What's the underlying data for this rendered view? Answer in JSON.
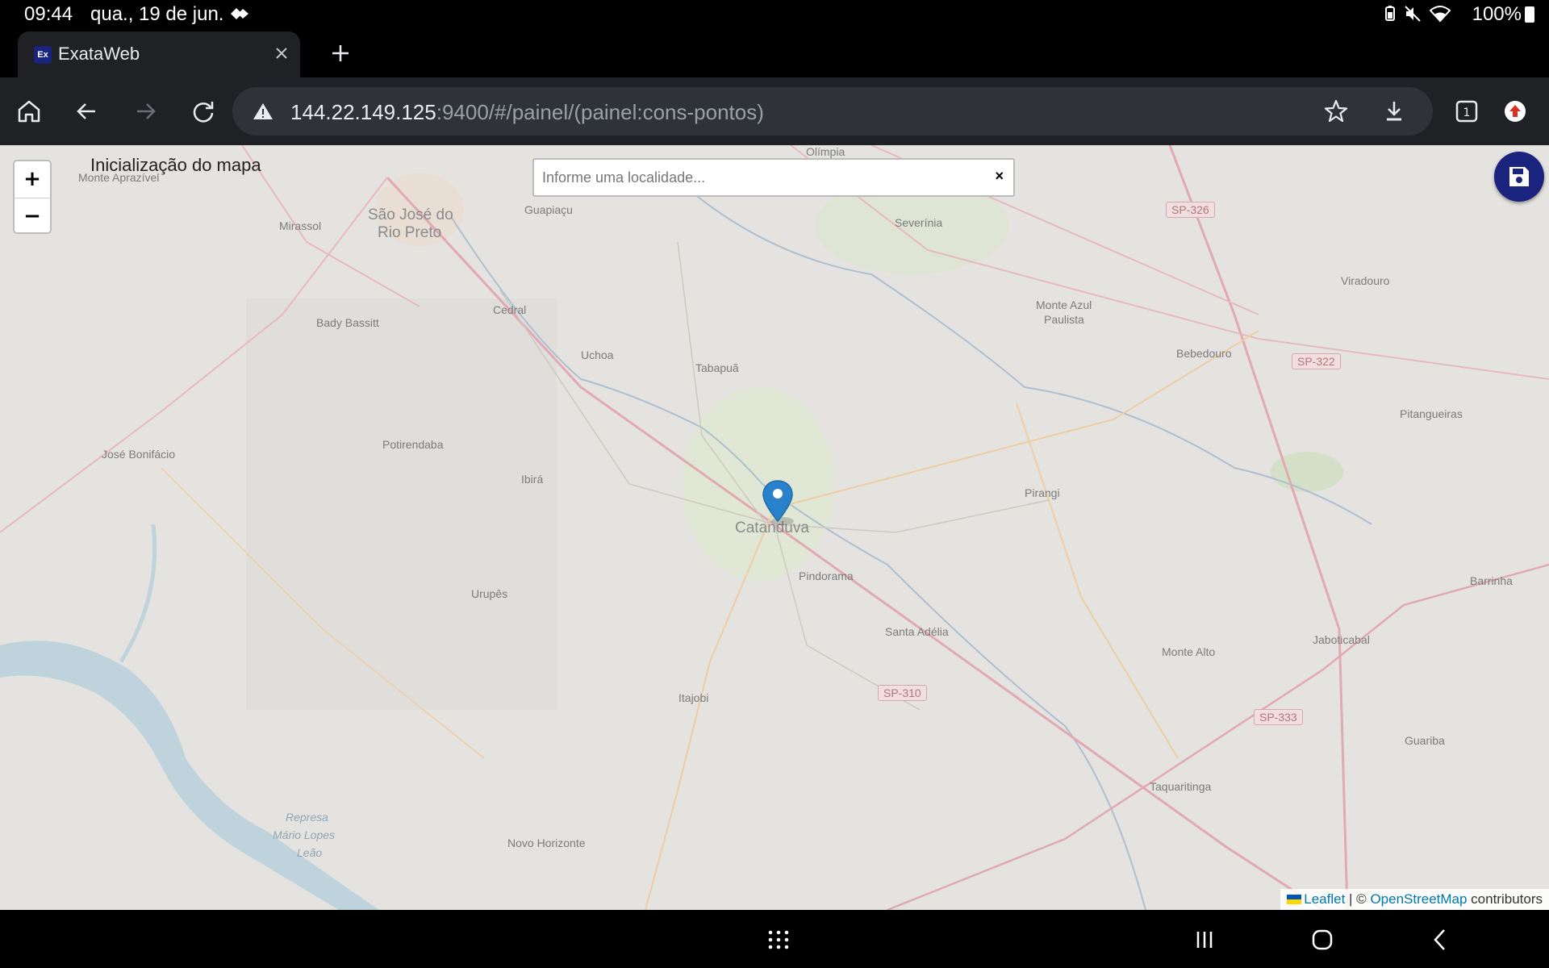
{
  "status_bar": {
    "time": "09:44",
    "date": "qua., 19 de jun.",
    "battery": "100%"
  },
  "tab": {
    "favicon": "Ex",
    "title": "ExataWeb"
  },
  "address_bar": {
    "host": "144.22.149.125",
    "path": ":9400/#/painel/(painel:cons-pontos)"
  },
  "map": {
    "init_label": "Inicialização do mapa",
    "search": {
      "placeholder": "Informe uma localidade...",
      "clear_label": "×"
    },
    "zoom_in": "+",
    "zoom_out": "−",
    "marker_label": "Catanduva",
    "places": {
      "olimpia": "Olímpia",
      "monte_aprazivel": "Monte Aprazível",
      "sao_jose": "São José do",
      "rio_preto": "Rio Preto",
      "mirassol": "Mirassol",
      "guapiacu": "Guapiaçu",
      "severinia": "Severínia",
      "cedral": "Cedral",
      "bady_bassitt": "Bady Bassitt",
      "uchoa": "Uchoa",
      "tabapua": "Tabapuã",
      "monte_azul": "Monte Azul",
      "paulista": "Paulista",
      "viradouro": "Viradouro",
      "bebedouro": "Bebedouro",
      "pitangueiras": "Pitangueiras",
      "jose_bonifacio": "José Bonifácio",
      "potirendaba": "Potirendaba",
      "ibira": "Ibirá",
      "pirangi": "Pirangi",
      "pindorama": "Pindorama",
      "barrinha": "Barrinha",
      "urupes": "Urupês",
      "santa_adelia": "Santa Adélia",
      "monte_alto": "Monte Alto",
      "jaboticabal": "Jaboticabal",
      "itajobi": "Itajobi",
      "guariba": "Guariba",
      "taquaritinga": "Taquaritinga",
      "represa1": "Represa",
      "represa2": "Mário Lopes",
      "represa3": "Leão",
      "novo_horizonte": "Novo Horizonte"
    },
    "shields": {
      "sp326": "SP-326",
      "sp322": "SP-322",
      "sp310": "SP-310",
      "sp333": "SP-333"
    },
    "attribution": {
      "leaflet": "Leaflet",
      "separator": " | © ",
      "osm": "OpenStreetMap",
      "contributors": " contributors"
    }
  }
}
